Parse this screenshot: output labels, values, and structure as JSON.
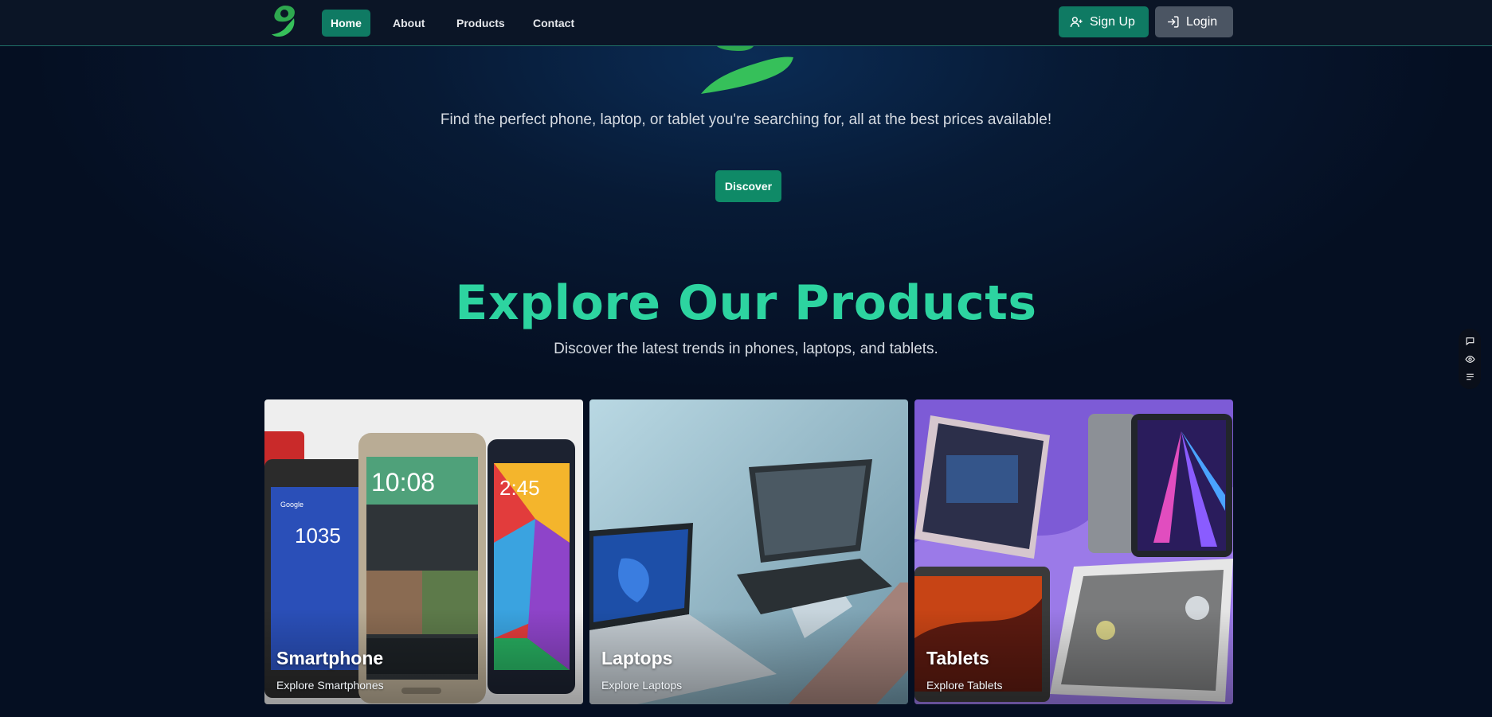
{
  "nav": {
    "logo_icon": "g-leaf-logo",
    "links": [
      "Home",
      "About",
      "Products",
      "Contact"
    ],
    "active": "Home",
    "signup_label": "Sign Up",
    "login_label": "Login"
  },
  "hero": {
    "tagline": "Find the perfect phone, laptop, or tablet you're searching for, all at the best prices available!",
    "discover_label": "Discover"
  },
  "products": {
    "title": "Explore Our Products",
    "subtitle": "Discover the latest trends in phones, laptops, and tablets.",
    "cards": [
      {
        "title": "Smartphone",
        "subtitle": "Explore Smartphones"
      },
      {
        "title": "Laptops",
        "subtitle": "Explore Laptops"
      },
      {
        "title": "Tablets",
        "subtitle": "Explore Tablets"
      }
    ]
  },
  "side_widget": {
    "icons": [
      "chat-icon",
      "eye-icon",
      "list-icon"
    ]
  },
  "colors": {
    "accent": "#2dd4a0",
    "button_green": "#0f7a63",
    "nav_bg": "#0b1526",
    "page_bg": "#071a35"
  }
}
